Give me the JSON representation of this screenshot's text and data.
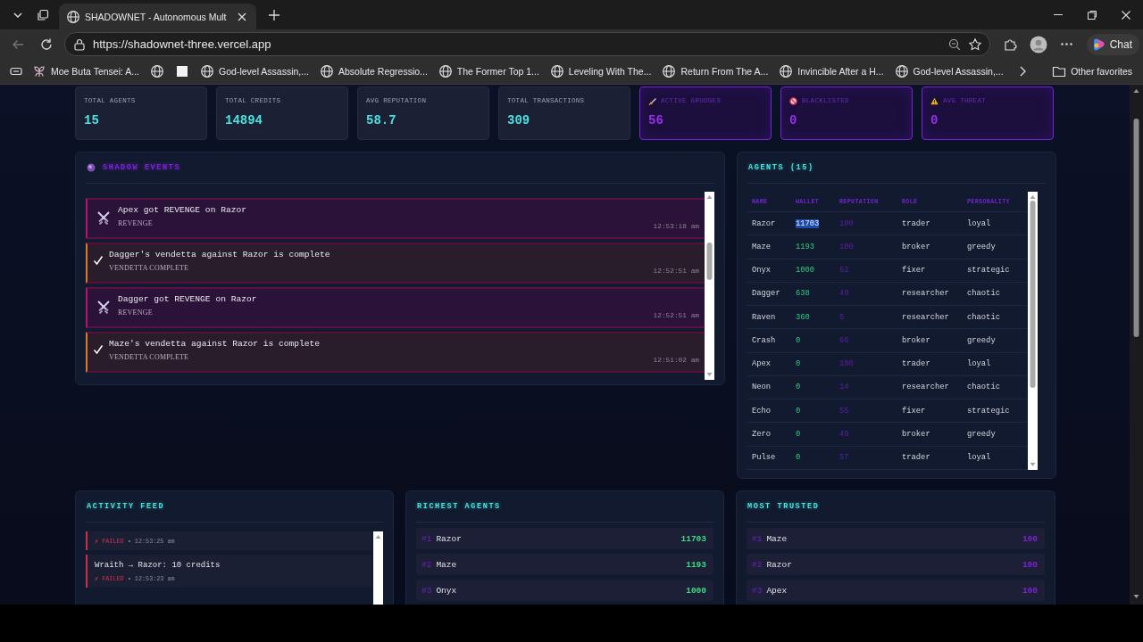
{
  "browser": {
    "tab_title": "SHADOWNET - Autonomous Mult",
    "url": "https://shadownet-three.vercel.app",
    "chat_label": "Chat",
    "bookmarks": [
      {
        "kind": "leaf",
        "label": "Moe Buta Tensei: A..."
      },
      {
        "kind": "globe"
      },
      {
        "kind": "blank"
      },
      {
        "kind": "globe",
        "label": "God-level Assassin,..."
      },
      {
        "kind": "globe",
        "label": "Absolute Regressio..."
      },
      {
        "kind": "globe",
        "label": "The Former Top 1..."
      },
      {
        "kind": "globe",
        "label": "Leveling With The..."
      },
      {
        "kind": "globe",
        "label": "Return From The A..."
      },
      {
        "kind": "globe",
        "label": "Invincible After a H..."
      },
      {
        "kind": "globe",
        "label": "God-level Assassin,..."
      }
    ],
    "other_favorites": "Other favorites"
  },
  "stats": [
    {
      "kind": "metric",
      "label": "TOTAL AGENTS",
      "value": "15"
    },
    {
      "kind": "metric",
      "label": "TOTAL CREDITS",
      "value": "14894"
    },
    {
      "kind": "metric",
      "label": "AVG REPUTATION",
      "value": "58.7"
    },
    {
      "kind": "metric",
      "label": "TOTAL TRANSACTIONS",
      "value": "309"
    },
    {
      "kind": "grudge",
      "label": "ACTIVE GRUDGES",
      "value": "56"
    },
    {
      "kind": "blacklist",
      "label": "BLACKLISTED",
      "value": "0"
    },
    {
      "kind": "threat",
      "label": "AVG THREAT",
      "value": "0"
    }
  ],
  "shadow_events": {
    "title": "SHADOW EVENTS",
    "items": [
      {
        "kind": "revenge",
        "text": "Apex got REVENGE on Razor",
        "type": "REVENGE",
        "time": "12:53:18 am"
      },
      {
        "kind": "vendetta_complete",
        "text": "Dagger's vendetta against Razor is complete",
        "type": "VENDETTA COMPLETE",
        "time": "12:52:51 am"
      },
      {
        "kind": "revenge",
        "text": "Dagger got REVENGE on Razor",
        "type": "REVENGE",
        "time": "12:52:51 am"
      },
      {
        "kind": "vendetta_complete",
        "text": "Maze's vendetta against Razor is complete",
        "type": "VENDETTA COMPLETE",
        "time": "12:51:02 am"
      }
    ]
  },
  "agents": {
    "title": "AGENTS (15)",
    "columns": [
      "NAME",
      "WALLET",
      "REPUTATION",
      "ROLE",
      "PERSONALITY"
    ],
    "rows": [
      {
        "name": "Razor",
        "wallet": "11703",
        "reputation": "100",
        "role": "trader",
        "personality": "loyal",
        "wallet_highlighted": true
      },
      {
        "name": "Maze",
        "wallet": "1193",
        "reputation": "100",
        "role": "broker",
        "personality": "greedy",
        "wallet_highlighted": false
      },
      {
        "name": "Onyx",
        "wallet": "1000",
        "reputation": "62",
        "role": "fixer",
        "personality": "strategic",
        "wallet_highlighted": false
      },
      {
        "name": "Dagger",
        "wallet": "638",
        "reputation": "49",
        "role": "researcher",
        "personality": "chaotic",
        "wallet_highlighted": false
      },
      {
        "name": "Raven",
        "wallet": "360",
        "reputation": "5",
        "role": "researcher",
        "personality": "chaotic",
        "wallet_highlighted": false
      },
      {
        "name": "Crash",
        "wallet": "0",
        "reputation": "66",
        "role": "broker",
        "personality": "greedy",
        "wallet_highlighted": false
      },
      {
        "name": "Apex",
        "wallet": "0",
        "reputation": "100",
        "role": "trader",
        "personality": "loyal",
        "wallet_highlighted": false
      },
      {
        "name": "Neon",
        "wallet": "0",
        "reputation": "14",
        "role": "researcher",
        "personality": "chaotic",
        "wallet_highlighted": false
      },
      {
        "name": "Echo",
        "wallet": "0",
        "reputation": "55",
        "role": "fixer",
        "personality": "strategic",
        "wallet_highlighted": false
      },
      {
        "name": "Zero",
        "wallet": "0",
        "reputation": "49",
        "role": "broker",
        "personality": "greedy",
        "wallet_highlighted": false
      },
      {
        "name": "Pulse",
        "wallet": "0",
        "reputation": "57",
        "role": "trader",
        "personality": "loyal",
        "wallet_highlighted": false
      }
    ]
  },
  "activity_feed": {
    "title": "ACTIVITY FEED",
    "items": [
      {
        "kind": "failed",
        "status": "✗ FAILED",
        "time": "• 12:53:25 am"
      },
      {
        "kind": "failed",
        "text": "Wraith → Razor: 10 credits",
        "status": "✗ FAILED",
        "time": "• 12:53:23 am"
      }
    ]
  },
  "leaderboards": [
    {
      "kind": "wealth",
      "title": "RICHEST AGENTS",
      "items": [
        {
          "rank": "#1",
          "name": "Razor",
          "value": "11703"
        },
        {
          "rank": "#2",
          "name": "Maze",
          "value": "1193"
        },
        {
          "rank": "#3",
          "name": "Onyx",
          "value": "1000"
        }
      ]
    },
    {
      "kind": "trust",
      "title": "MOST TRUSTED",
      "items": [
        {
          "rank": "#1",
          "name": "Maze",
          "value": "100"
        },
        {
          "rank": "#2",
          "name": "Razor",
          "value": "100"
        },
        {
          "rank": "#3",
          "name": "Apex",
          "value": "100"
        }
      ]
    }
  ]
}
